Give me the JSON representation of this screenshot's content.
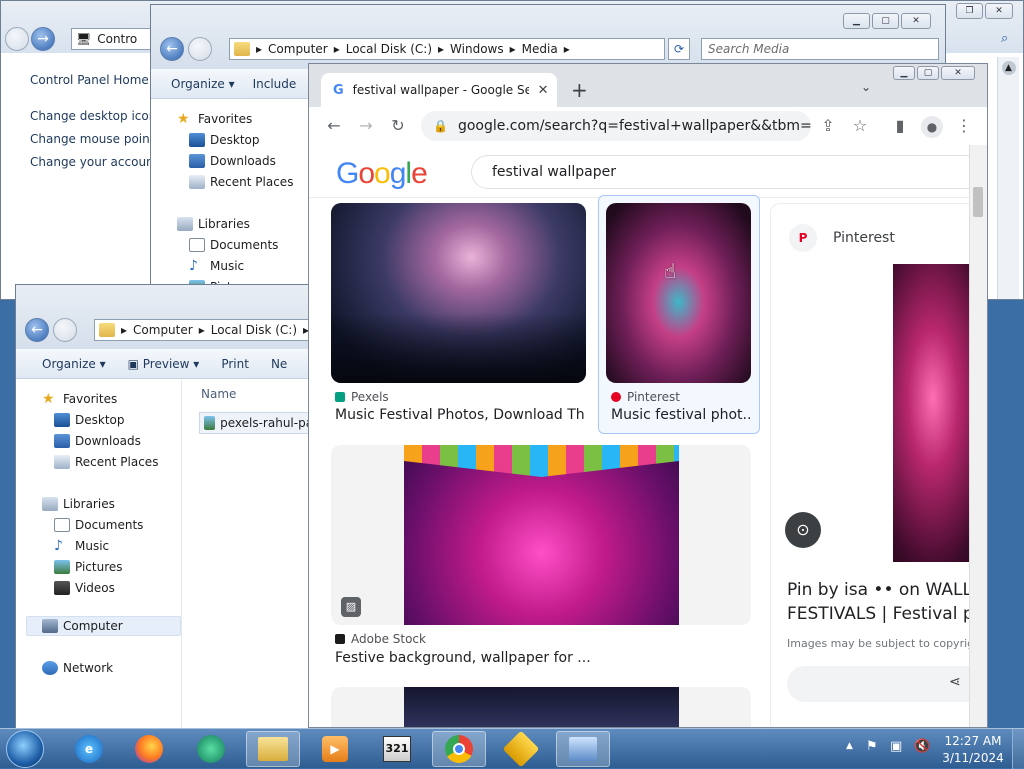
{
  "control_panel": {
    "title_partial": "Contro",
    "home_link": "Control Panel Home",
    "links": [
      "Change desktop icons",
      "Change mouse pointer",
      "Change your account p"
    ]
  },
  "explorer_back": {
    "address": [
      "Computer",
      "Local Disk (C:)",
      "Windows",
      "Media"
    ],
    "search_placeholder": "Search Media",
    "toolbar": [
      "Organize ▾",
      "Include"
    ],
    "nav": {
      "favorites": "Favorites",
      "fav_items": [
        "Desktop",
        "Downloads",
        "Recent Places"
      ],
      "libraries": "Libraries",
      "lib_items": [
        "Documents",
        "Music",
        "Pict"
      ]
    }
  },
  "explorer_front": {
    "address": [
      "Computer",
      "Local Disk (C:)"
    ],
    "toolbar": [
      "Organize ▾",
      "Preview ▾",
      "Print",
      "Ne"
    ],
    "column_name": "Name",
    "file": "pexels-rahul-par",
    "nav": {
      "favorites": "Favorites",
      "fav_items": [
        "Desktop",
        "Downloads",
        "Recent Places"
      ],
      "libraries": "Libraries",
      "lib_items": [
        "Documents",
        "Music",
        "Pictures",
        "Videos"
      ],
      "computer": "Computer",
      "network": "Network"
    }
  },
  "chrome": {
    "tab_title": "festival wallpaper - Google Searc",
    "url": "google.com/search?q=festival+wallpaper&&tbm=isch...",
    "logo": "Google",
    "query": "festival wallpaper",
    "results": [
      {
        "source": "Pexels",
        "title": "Music Festival Photos, Download Th..."
      },
      {
        "source": "Pinterest",
        "title": "Music festival phot..."
      },
      {
        "source": "Adobe Stock",
        "title": "Festive background, wallpaper for ..."
      }
    ],
    "side_panel": {
      "source": "Pinterest",
      "title_line1": "Pin by isa •• on WALLPA",
      "title_line2": "FESTIVALS | Festival ph",
      "notice": "Images may be subject to copyrig"
    }
  },
  "taskbar": {
    "time": "12:27 AM",
    "date": "3/11/2024"
  },
  "colors": {
    "taskbar": "#2e5d92",
    "google_blue": "#4285f4",
    "selected_border": "#a8c7fa"
  }
}
